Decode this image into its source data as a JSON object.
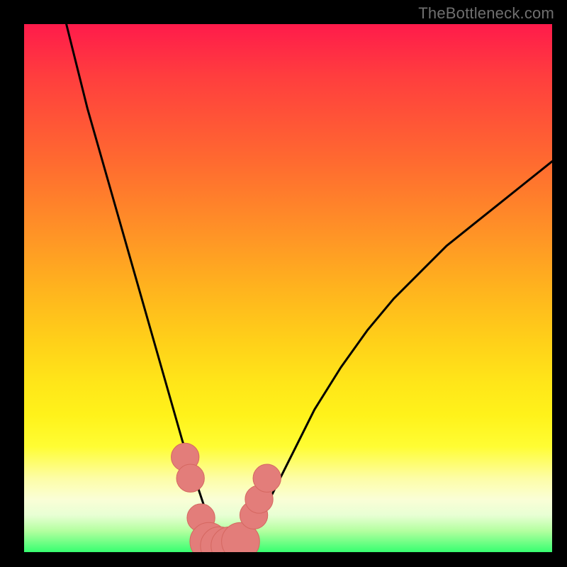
{
  "watermark": "TheBottleneck.com",
  "colors": {
    "background": "#000000",
    "curve": "#000000",
    "marker_fill": "#e37d7a",
    "marker_stroke": "#d56760",
    "gradient_top": "#ff1b4b",
    "gradient_bottom": "#37ff70"
  },
  "chart_data": {
    "type": "line",
    "title": "",
    "xlabel": "",
    "ylabel": "",
    "xlim": [
      0,
      100
    ],
    "ylim": [
      0,
      100
    ],
    "grid": false,
    "legend": false,
    "series": [
      {
        "name": "bottleneck-curve",
        "x": [
          8,
          10,
          12,
          14,
          16,
          18,
          20,
          22,
          24,
          26,
          28,
          30,
          32,
          33,
          34,
          35,
          36,
          37,
          38,
          39,
          40,
          42,
          44,
          46,
          50,
          55,
          60,
          65,
          70,
          75,
          80,
          85,
          90,
          95,
          100
        ],
        "values": [
          100,
          92,
          84,
          77,
          70,
          63,
          56,
          49,
          42,
          35,
          28,
          21,
          15,
          12,
          9,
          6,
          3,
          1.5,
          1,
          1,
          1.2,
          2.5,
          5,
          9,
          17,
          27,
          35,
          42,
          48,
          53,
          58,
          62,
          66,
          70,
          74
        ]
      }
    ],
    "markers": [
      {
        "x": 30.5,
        "y": 18,
        "r": 2.2
      },
      {
        "x": 31.5,
        "y": 14,
        "r": 2.2
      },
      {
        "x": 33.5,
        "y": 6.5,
        "r": 2.2
      },
      {
        "x": 35.0,
        "y": 2.0,
        "r": 3.0
      },
      {
        "x": 37.0,
        "y": 1.2,
        "r": 3.0
      },
      {
        "x": 39.0,
        "y": 1.2,
        "r": 3.0
      },
      {
        "x": 41.0,
        "y": 2.0,
        "r": 3.0
      },
      {
        "x": 43.5,
        "y": 7.0,
        "r": 2.2
      },
      {
        "x": 44.5,
        "y": 10.0,
        "r": 2.2
      },
      {
        "x": 46.0,
        "y": 14.0,
        "r": 2.2
      }
    ]
  }
}
